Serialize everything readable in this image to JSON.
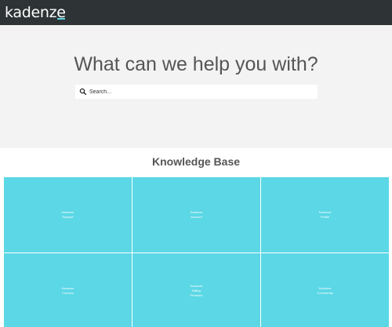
{
  "brand": {
    "logo_main": "kadenz",
    "logo_accent": "e"
  },
  "hero": {
    "title": "What can we help you with?",
    "search_placeholder": "Search..."
  },
  "knowledge_base": {
    "title": "Knowledge Base",
    "tiles": [
      {
        "label": "Kadenze Support"
      },
      {
        "label": "Kadenze Account"
      },
      {
        "label": "Kadenze Profile"
      },
      {
        "label": "Kadenze Courses"
      },
      {
        "label": "Kadenze Billing Premium"
      },
      {
        "label": "Kadenze Community"
      }
    ]
  },
  "colors": {
    "topbar": "#2e3336",
    "hero_bg": "#f3f3f3",
    "tile": "#5bd7e5",
    "accent": "#5bd5e4"
  }
}
